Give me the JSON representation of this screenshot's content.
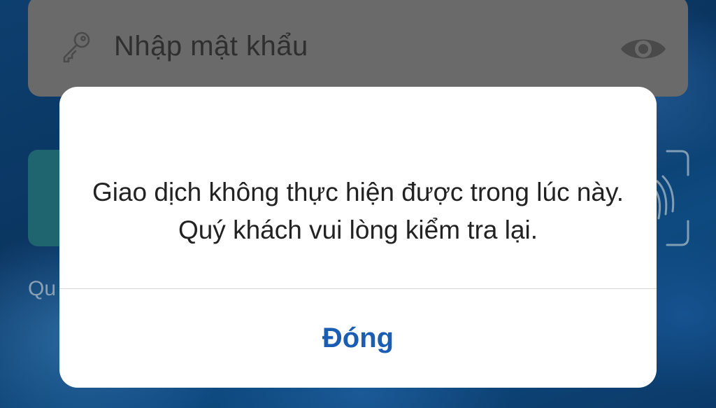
{
  "password_field": {
    "placeholder": "Nhập mật khẩu",
    "leading_icon": "key-icon",
    "trailing_icon": "eye-icon"
  },
  "hint_fragment": "Qu",
  "fingerprint_icon": "fingerprint-icon",
  "dialog": {
    "message": "Giao dịch không thực hiện được trong lúc này. Quý khách vui lòng kiểm tra lại.",
    "button_label": "Đóng"
  },
  "colors": {
    "accent": "#1b5db3",
    "background": "#0d3f6e",
    "field": "#6a6a6a",
    "login_button": "#1f6570"
  }
}
